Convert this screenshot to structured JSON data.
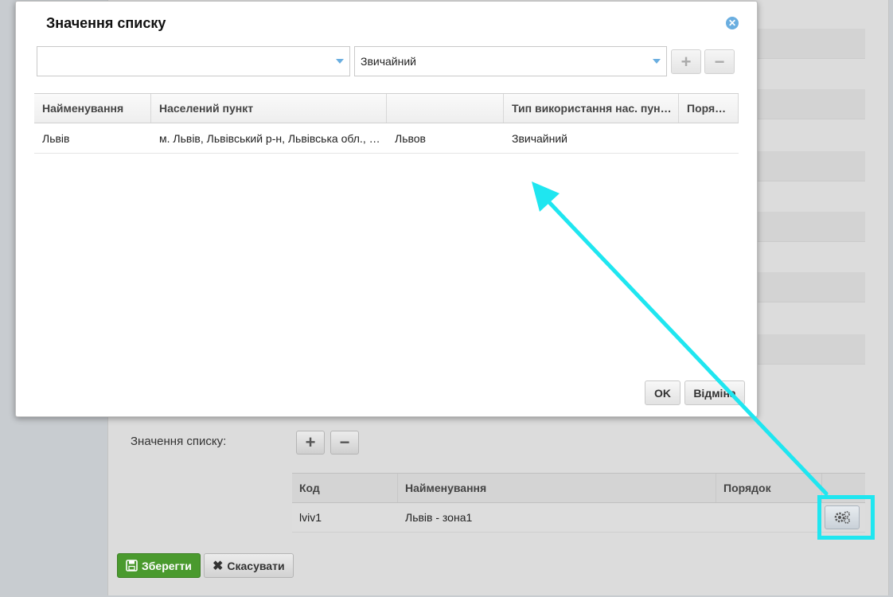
{
  "background": {
    "list_values_label": "Значення списку:",
    "table": {
      "headers": [
        "Код",
        "Найменування",
        "Порядок",
        ""
      ],
      "rows": [
        {
          "code": "lviv1",
          "name": "Львів - зона1",
          "order": ""
        }
      ]
    },
    "save_label": "Зберегти",
    "cancel_label": "Скасувати"
  },
  "modal": {
    "title": "Значення списку",
    "filter_value": "",
    "type_value": "Звичайний",
    "grid": {
      "headers": [
        "Найменування",
        "Населений пункт",
        "",
        "Тип використання нас. пун…",
        "Поря…"
      ],
      "rows": [
        {
          "name": "Львів",
          "settlement": "м. Львів, Львівський р-н, Львівська обл., …",
          "alt_name": "Львов",
          "usage_type": "Звичайний",
          "order": ""
        }
      ]
    },
    "ok_label": "OK",
    "cancel_label": "Відміна"
  },
  "colors": {
    "annotation_arrow": "#1fe6f0",
    "save_button": "#4a9a2e",
    "accent": "#6aaee0"
  }
}
